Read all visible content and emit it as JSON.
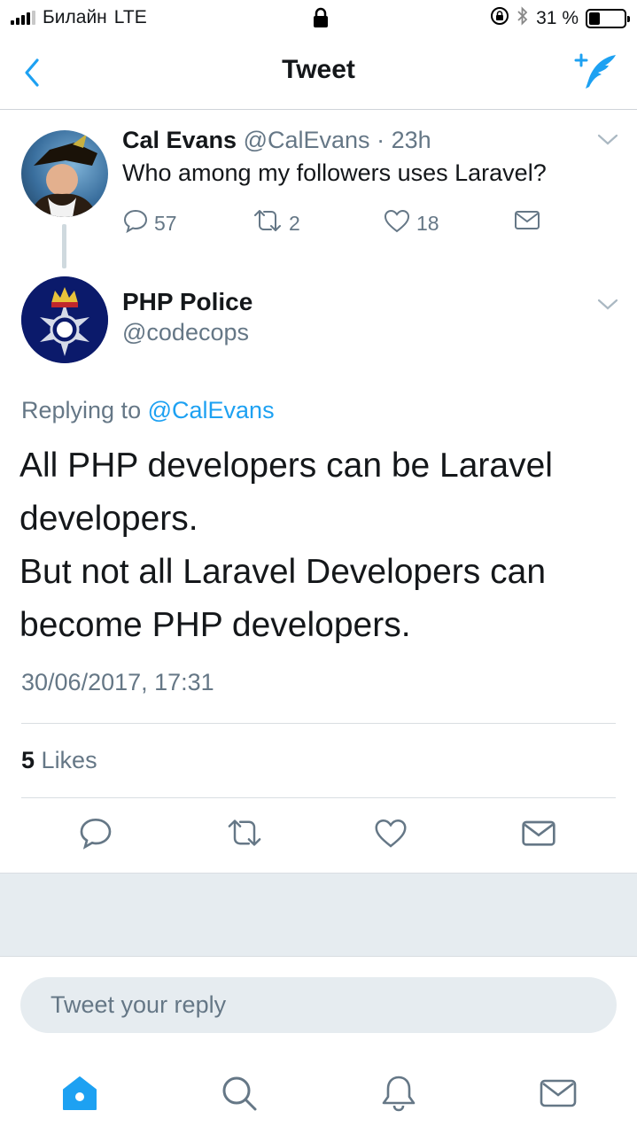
{
  "status_bar": {
    "carrier": "Билайн",
    "network": "LTE",
    "battery": "31 %",
    "battery_level": 0.31
  },
  "nav": {
    "title": "Tweet",
    "back_icon": "chevron-left-icon",
    "compose_icon": "compose-tweet-icon"
  },
  "parent_tweet": {
    "name": "Cal Evans",
    "handle": "@CalEvans",
    "separator": "·",
    "time": "23h",
    "text": "Who among my followers uses Laravel?",
    "replies": "57",
    "retweets": "2",
    "likes": "18"
  },
  "main_tweet": {
    "name": "PHP Police",
    "handle": "@codecops",
    "replying_prefix": "Replying to",
    "replying_to": "@CalEvans",
    "text_line1": "All PHP developers can be Laravel developers.",
    "text_line2": "But not all Laravel Developers can become PHP developers.",
    "date": "30/06/2017, 17:31",
    "likes_count": "5",
    "likes_label": "Likes"
  },
  "reply": {
    "placeholder": "Tweet your reply"
  },
  "tabbar": {
    "items": [
      "home-icon",
      "search-icon",
      "notifications-icon",
      "messages-icon"
    ],
    "active": "home-icon"
  },
  "colors": {
    "accent": "#1da1f2",
    "muted": "#657786",
    "text": "#14171a",
    "band": "#e6ecf0"
  }
}
